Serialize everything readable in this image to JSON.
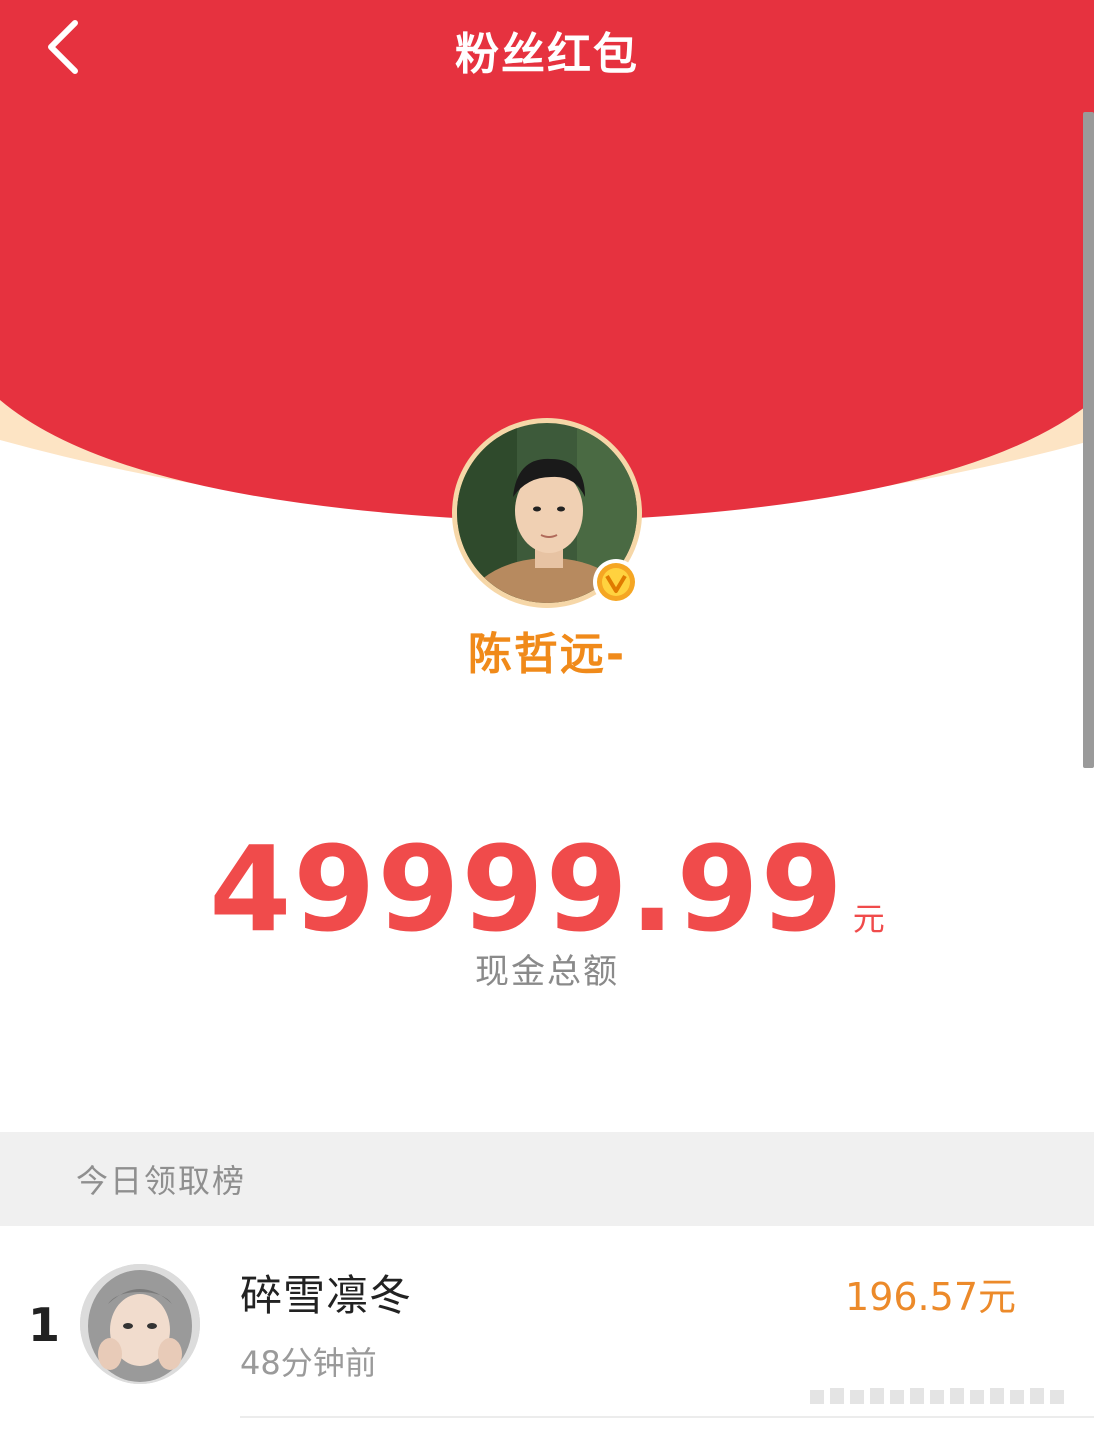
{
  "header": {
    "title": "粉丝红包",
    "back_icon": "chevron-left-icon"
  },
  "colors": {
    "header_red": "#e6323f",
    "peach": "#fde4c4",
    "amount_red": "#f04b4b",
    "name_orange": "#f08a1a"
  },
  "creator": {
    "name": "陈哲远-",
    "verified_icon": "verified-badge-icon"
  },
  "amount": {
    "value": "49999.99",
    "unit": "元",
    "label": "现金总额"
  },
  "leaderboard": {
    "title": "今日领取榜",
    "rows": [
      {
        "rank": "1",
        "name": "碎雪凛冬",
        "time": "48分钟前",
        "amount": "196.57元"
      }
    ]
  }
}
